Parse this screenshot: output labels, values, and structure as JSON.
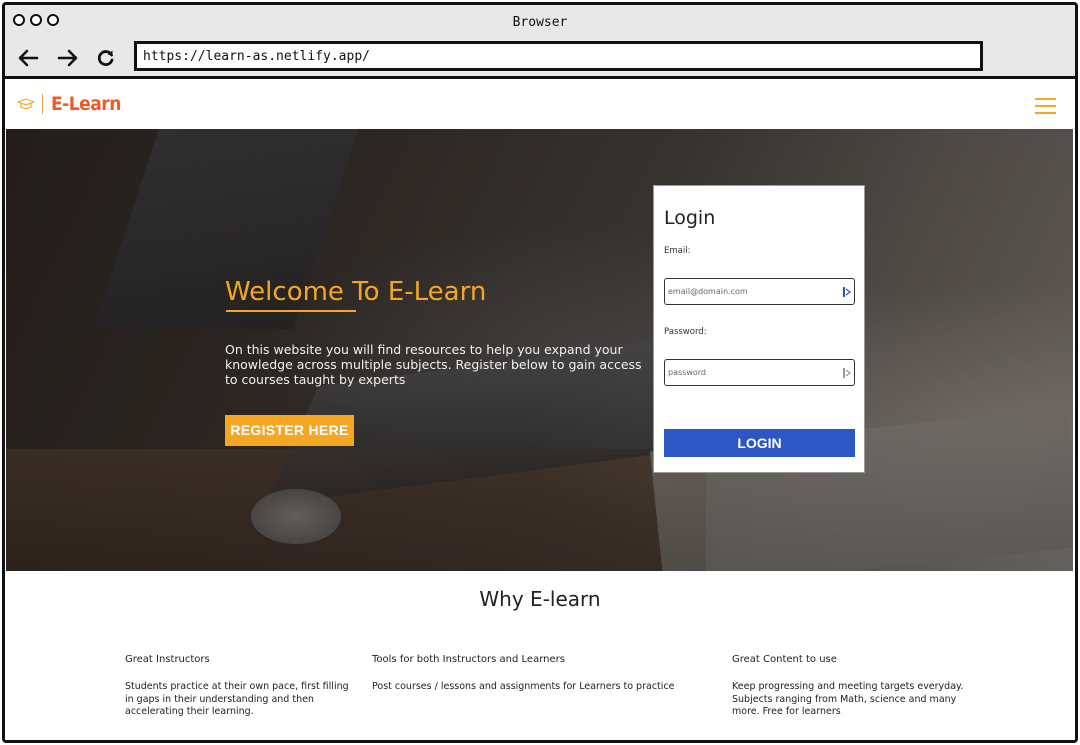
{
  "browser": {
    "title": "Browser",
    "url": "https://learn-as.netlify.app/",
    "controls": {
      "back": "back-icon",
      "forward": "forward-icon",
      "reload": "reload-icon"
    }
  },
  "site": {
    "logo_text": "E-Learn",
    "logo_icon": "graduation-cap-icon",
    "menu_icon": "hamburger-menu-icon",
    "brand_color": "#f15a24",
    "accent_color": "#f5a623"
  },
  "hero": {
    "heading": "Welcome To E-Learn",
    "description": "On this website you will find resources to help you expand your knowledge across multiple subjects. Register below to gain access to courses taught by experts",
    "register_label": "REGISTER HERE"
  },
  "login": {
    "title": "Login",
    "email_label": "Email:",
    "email_placeholder": "email@domain.com",
    "password_label": "Password:",
    "password_placeholder": "password",
    "button_label": "LOGIN",
    "button_color": "#2c57c2"
  },
  "why": {
    "title": "Why E-learn",
    "features": [
      {
        "title": "Great Instructors",
        "description": "Students practice at their own pace, first filling in gaps in their understanding and then accelerating their learning."
      },
      {
        "title": "Tools for both Instructors and Learners",
        "description": "Post courses / lessons and assignments for Learners to practice"
      },
      {
        "title": "Great Content to use",
        "description": "Keep progressing and meeting targets everyday. Subjects ranging from Math, science and many more. Free for learners"
      }
    ]
  }
}
